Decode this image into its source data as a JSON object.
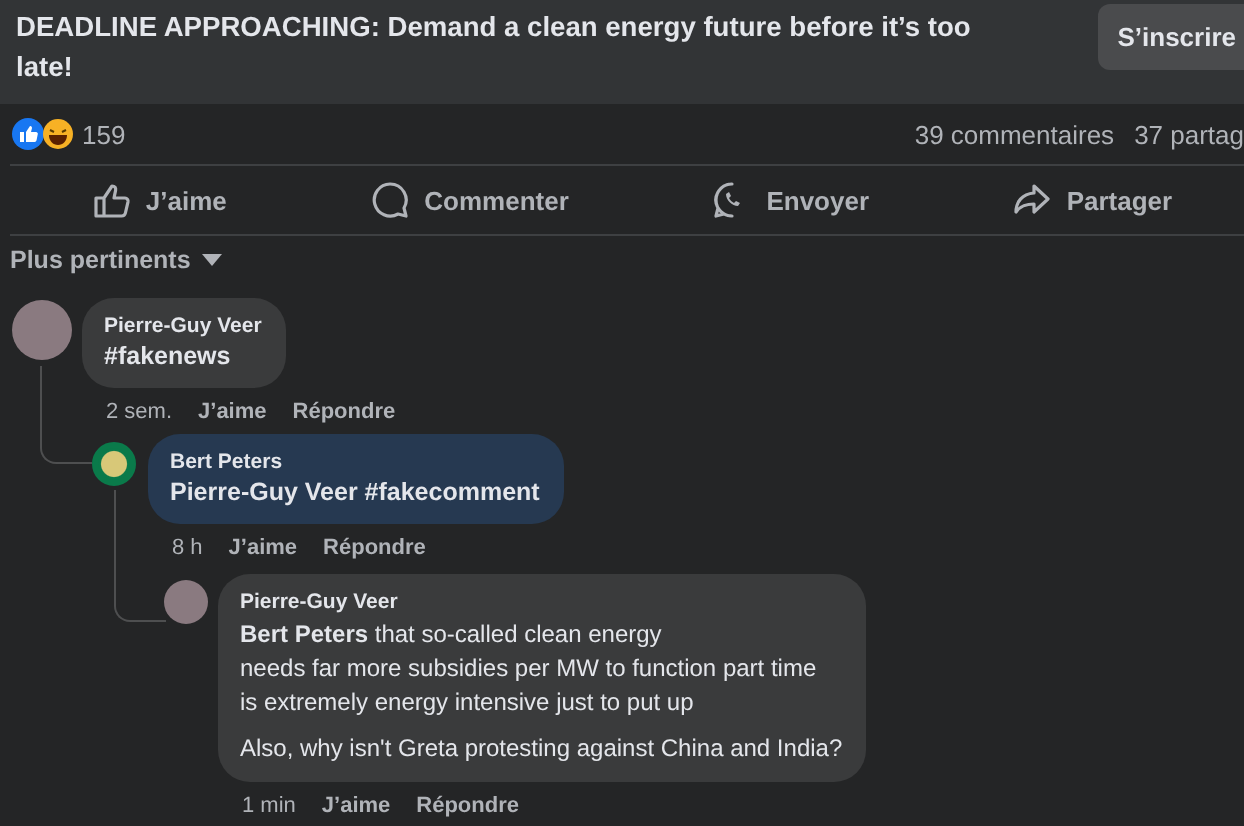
{
  "post": {
    "title": "DEADLINE APPROACHING: Demand a clean energy future before it’s too late!",
    "button": "S’inscrire"
  },
  "reactions": {
    "count": "159",
    "comments": "39 commentaires",
    "shares": "37 partag"
  },
  "actions": [
    {
      "kind": "like",
      "label": "J’aime"
    },
    {
      "kind": "comment",
      "label": "Commenter"
    },
    {
      "kind": "send",
      "label": "Envoyer"
    },
    {
      "kind": "share",
      "label": "Partager"
    }
  ],
  "sort": {
    "label": "Plus pertinents"
  },
  "comments": [
    {
      "author": "Pierre-Guy Veer",
      "paragraphs": [
        "#fakenews"
      ],
      "highlighted": false,
      "kind": "photo",
      "time": "2 sem.",
      "like": "J’aime",
      "reply": "Répondre",
      "children": [
        {
          "author": "Bert Peters",
          "paragraphs": [
            "Pierre-Guy Veer #fakecomment"
          ],
          "highlighted": true,
          "kind": "seal",
          "time": "8 h",
          "like": "J’aime",
          "reply": "Répondre",
          "children": [
            {
              "author": "Pierre-Guy Veer",
              "paragraphs": [
                "**Bert Peters** that so-called clean energy\nneeds far more subsidies per MW to function part time\nis extremely energy intensive just to put up",
                "Also, why isn't Greta protesting against China and India?"
              ],
              "highlighted": false,
              "kind": "photo",
              "time": "1 min",
              "like": "J’aime",
              "reply": "Répondre"
            }
          ]
        }
      ]
    }
  ]
}
